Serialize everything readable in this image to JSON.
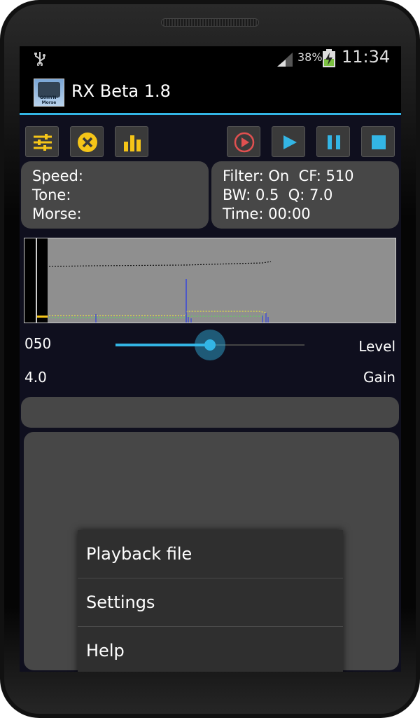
{
  "status_bar": {
    "battery_percent": "38%",
    "time": "11:34",
    "icons": [
      "usb-icon",
      "signal-icon",
      "battery-charging-icon"
    ]
  },
  "action_bar": {
    "logo_text": "G0HYN-Morse",
    "title": "RX Beta 1.8"
  },
  "toolbar": {
    "buttons": [
      "settings-sliders-icon",
      "clear-icon",
      "chart-bars-icon",
      "record-icon",
      "play-icon",
      "pause-icon",
      "stop-icon"
    ]
  },
  "info_left": {
    "speed_label": "Speed:",
    "tone_label": "Tone:",
    "morse_label": "Morse:"
  },
  "info_right": {
    "filter_line": "Filter: On  CF: 510",
    "bw_line": "BW: 0.5  Q: 7.0",
    "time_line": "Time: 00:00"
  },
  "level": {
    "value": "050",
    "label": "Level",
    "slider_fraction": 0.5
  },
  "gain": {
    "value": "4.0",
    "label": "Gain"
  },
  "menu": {
    "items": [
      "Playback file",
      "Settings",
      "Help"
    ]
  },
  "colors": {
    "accent": "#33b5e5",
    "icon_yellow": "#f5c518",
    "icon_red": "#e05050",
    "panel": "#474747"
  }
}
